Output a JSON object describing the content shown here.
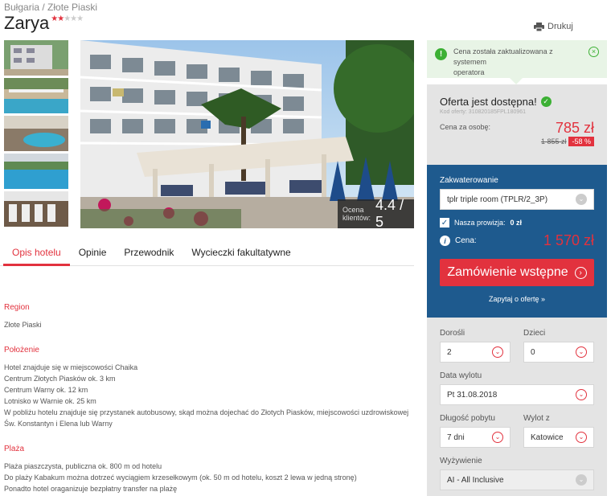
{
  "breadcrumb": "Bułgaria / Złote Piaski",
  "title": "Zarya",
  "stars": {
    "filled": 2,
    "total": 5
  },
  "print_label": "Drukuj",
  "rating": {
    "label_line1": "Ocena",
    "label_line2": "klientów:",
    "value": "4.4",
    "max": "/ 5"
  },
  "tabs": [
    "Opis hotelu",
    "Opinie",
    "Przewodnik",
    "Wycieczki fakultatywne"
  ],
  "sections": {
    "region": {
      "heading": "Region",
      "text": "Złote Piaski"
    },
    "location": {
      "heading": "Położenie",
      "lines": [
        "Hotel znajduje się w miejscowości Chaika",
        "Centrum Złotych Piasków ok. 3 km",
        "Centrum Warny ok. 12 km",
        "Lotnisko w Warnie ok. 25 km",
        "W pobliżu hotelu znajduje się przystanek autobusowy, skąd można dojechać do Złotych Piasków, miejscowości uzdrowiskowej",
        "Św. Konstantyn i Elena lub Warny"
      ]
    },
    "beach": {
      "heading": "Plaża",
      "lines": [
        "Plaża piaszczysta, publiczna ok. 800 m od hotelu",
        "Do plaży Kabakum można dotrzeć wyciągiem krzesełkowym (ok. 50 m od hotelu, koszt 2 lewa w jedną stronę)",
        "Ponadto hotel oraganizuje bezpłatny transfer na plażę"
      ]
    }
  },
  "notice": {
    "line1": "Cena została zaktualizowana z systemem",
    "line2": "operatora"
  },
  "offer": {
    "title": "Oferta jest dostępna!",
    "code": "Kod oferty: 310820185FPL180961",
    "price_label": "Cena za osobę:",
    "price": "785 zł",
    "old_price": "1 855 zł",
    "discount": "-58 %"
  },
  "booking": {
    "room_label": "Zakwaterowanie",
    "room_value": "tplr triple room (TPLR/2_3P)",
    "commission_label": "Nasza prowizja:",
    "commission_value": "0 zł",
    "total_label": "Cena:",
    "total_value": "1 570 zł",
    "order_button": "Zamówienie wstępne",
    "ask_link": "Zapytaj o ofertę »"
  },
  "filters": {
    "adults_label": "Dorośli",
    "adults_value": "2",
    "children_label": "Dzieci",
    "children_value": "0",
    "date_label": "Data wylotu",
    "date_value": "Pt 31.08.2018",
    "duration_label": "Długość pobytu",
    "duration_value": "7 dni",
    "from_label": "Wylot z",
    "from_value": "Katowice",
    "board_label": "Wyżywienie",
    "board_value": "AI - All Inclusive"
  },
  "colors": {
    "accent": "#e2323e",
    "panel_blue": "#1e5a8e",
    "panel_grey": "#e4e4e4",
    "notice_green": "#e8f4e6",
    "ok_green": "#3cb034"
  }
}
